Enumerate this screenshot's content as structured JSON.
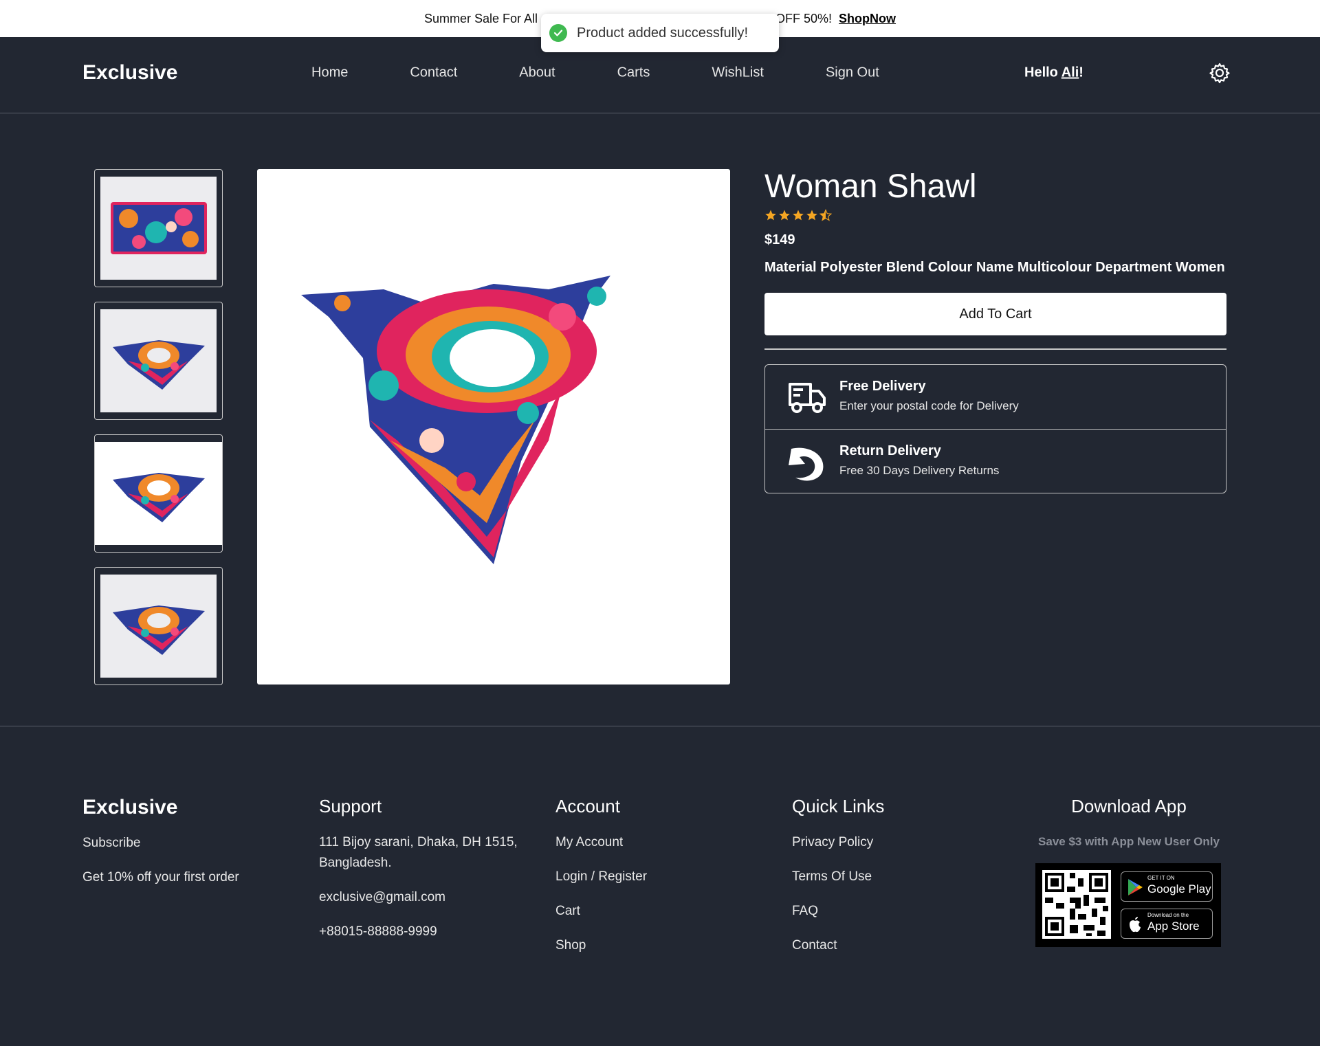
{
  "topbar": {
    "promo_text_left": "Summer Sale For All",
    "promo_text_right": "OFF 50%!",
    "promo_link": "ShopNow"
  },
  "toast": {
    "message": "Product added successfully!",
    "icon": "check-circle-icon",
    "color": "#3fb950"
  },
  "header": {
    "logo": "Exclusive",
    "nav": [
      "Home",
      "Contact",
      "About",
      "Carts",
      "WishList",
      "Sign Out"
    ],
    "greeting_prefix": "Hello ",
    "greeting_name": "Ali",
    "greeting_suffix": "!",
    "settings_icon": "gear-icon"
  },
  "product": {
    "title": "Woman Shawl",
    "rating": 4.5,
    "rating_max": 5,
    "star_color": "#f5a623",
    "price": "$149",
    "description": "Material Polyester Blend Colour Name Multicolour Department Women",
    "add_to_cart": "Add To Cart",
    "thumbnails": 4
  },
  "delivery": [
    {
      "icon": "truck-icon",
      "title": "Free Delivery",
      "subtitle": "Enter your postal code for Delivery"
    },
    {
      "icon": "return-icon",
      "title": "Return Delivery",
      "subtitle": "Free 30 Days Delivery Returns"
    }
  ],
  "footer": {
    "brand": "Exclusive",
    "subscribe": "Subscribe",
    "offer": "Get 10% off your first order",
    "support": {
      "heading": "Support",
      "address": "111 Bijoy sarani, Dhaka, DH 1515, Bangladesh.",
      "email": "exclusive@gmail.com",
      "phone": "+88015-88888-9999"
    },
    "account": {
      "heading": "Account",
      "items": [
        "My Account",
        "Login / Register",
        "Cart",
        "Shop"
      ]
    },
    "quick_links": {
      "heading": "Quick Links",
      "items": [
        "Privacy Policy",
        "Terms Of Use",
        "FAQ",
        "Contact"
      ]
    },
    "download": {
      "heading": "Download App",
      "save_text": "Save $3 with App New User Only",
      "google_small": "GET IT ON",
      "google_big": "Google Play",
      "apple_small": "Download on the",
      "apple_big": "App Store"
    }
  },
  "colors": {
    "background": "#222732",
    "topbar": "#ffffff"
  }
}
